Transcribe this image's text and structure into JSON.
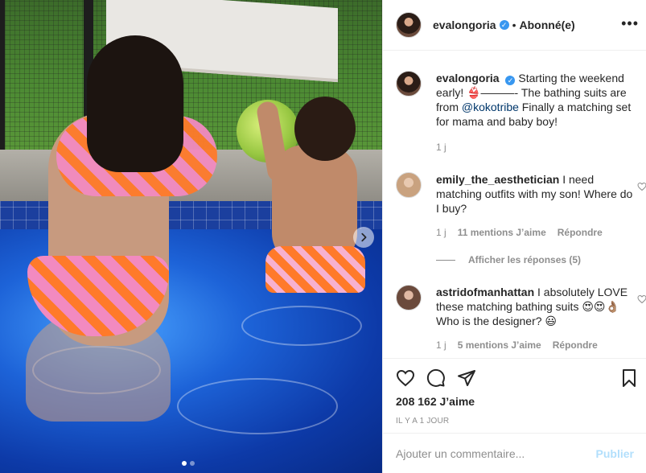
{
  "post": {
    "author": "evalongoria",
    "verified_icon": "✓",
    "separator": "•",
    "follow_status": "Abonné(e)",
    "more_icon": "•••",
    "carousel_dots": 2,
    "carousel_active": 0
  },
  "caption": {
    "username": "evalongoria",
    "text_before": "Starting the weekend early! 👙———- The bathing suits are from ",
    "mention": "@kokotribe",
    "text_after": " Finally a matching set for mama and baby boy!",
    "age": "1 j"
  },
  "comments": [
    {
      "username": "emily_the_aesthetician",
      "text": "I need matching outfits with my son! Where do I buy?",
      "age": "1 j",
      "likes": "11 mentions J’aime",
      "reply": "Répondre",
      "avatar_color": "#c9a27f"
    },
    {
      "username": "astridofmanhattan",
      "text": "I absolutely LOVE these matching bathing suits 😍😍👌🏽 Who is the designer? 😃",
      "age": "1 j",
      "likes": "5 mentions J’aime",
      "reply": "Répondre",
      "avatar_color": "#b68b78"
    }
  ],
  "view_replies": "Afficher les réponses (5)",
  "likes_count": "208 162 J’aime",
  "timestamp": "IL Y A 1 JOUR",
  "comment_input": {
    "placeholder": "Ajouter un commentaire...",
    "publish": "Publier"
  },
  "icons": [
    "heart-icon",
    "comment-icon",
    "share-icon",
    "bookmark-icon",
    "chevron-right-icon"
  ]
}
